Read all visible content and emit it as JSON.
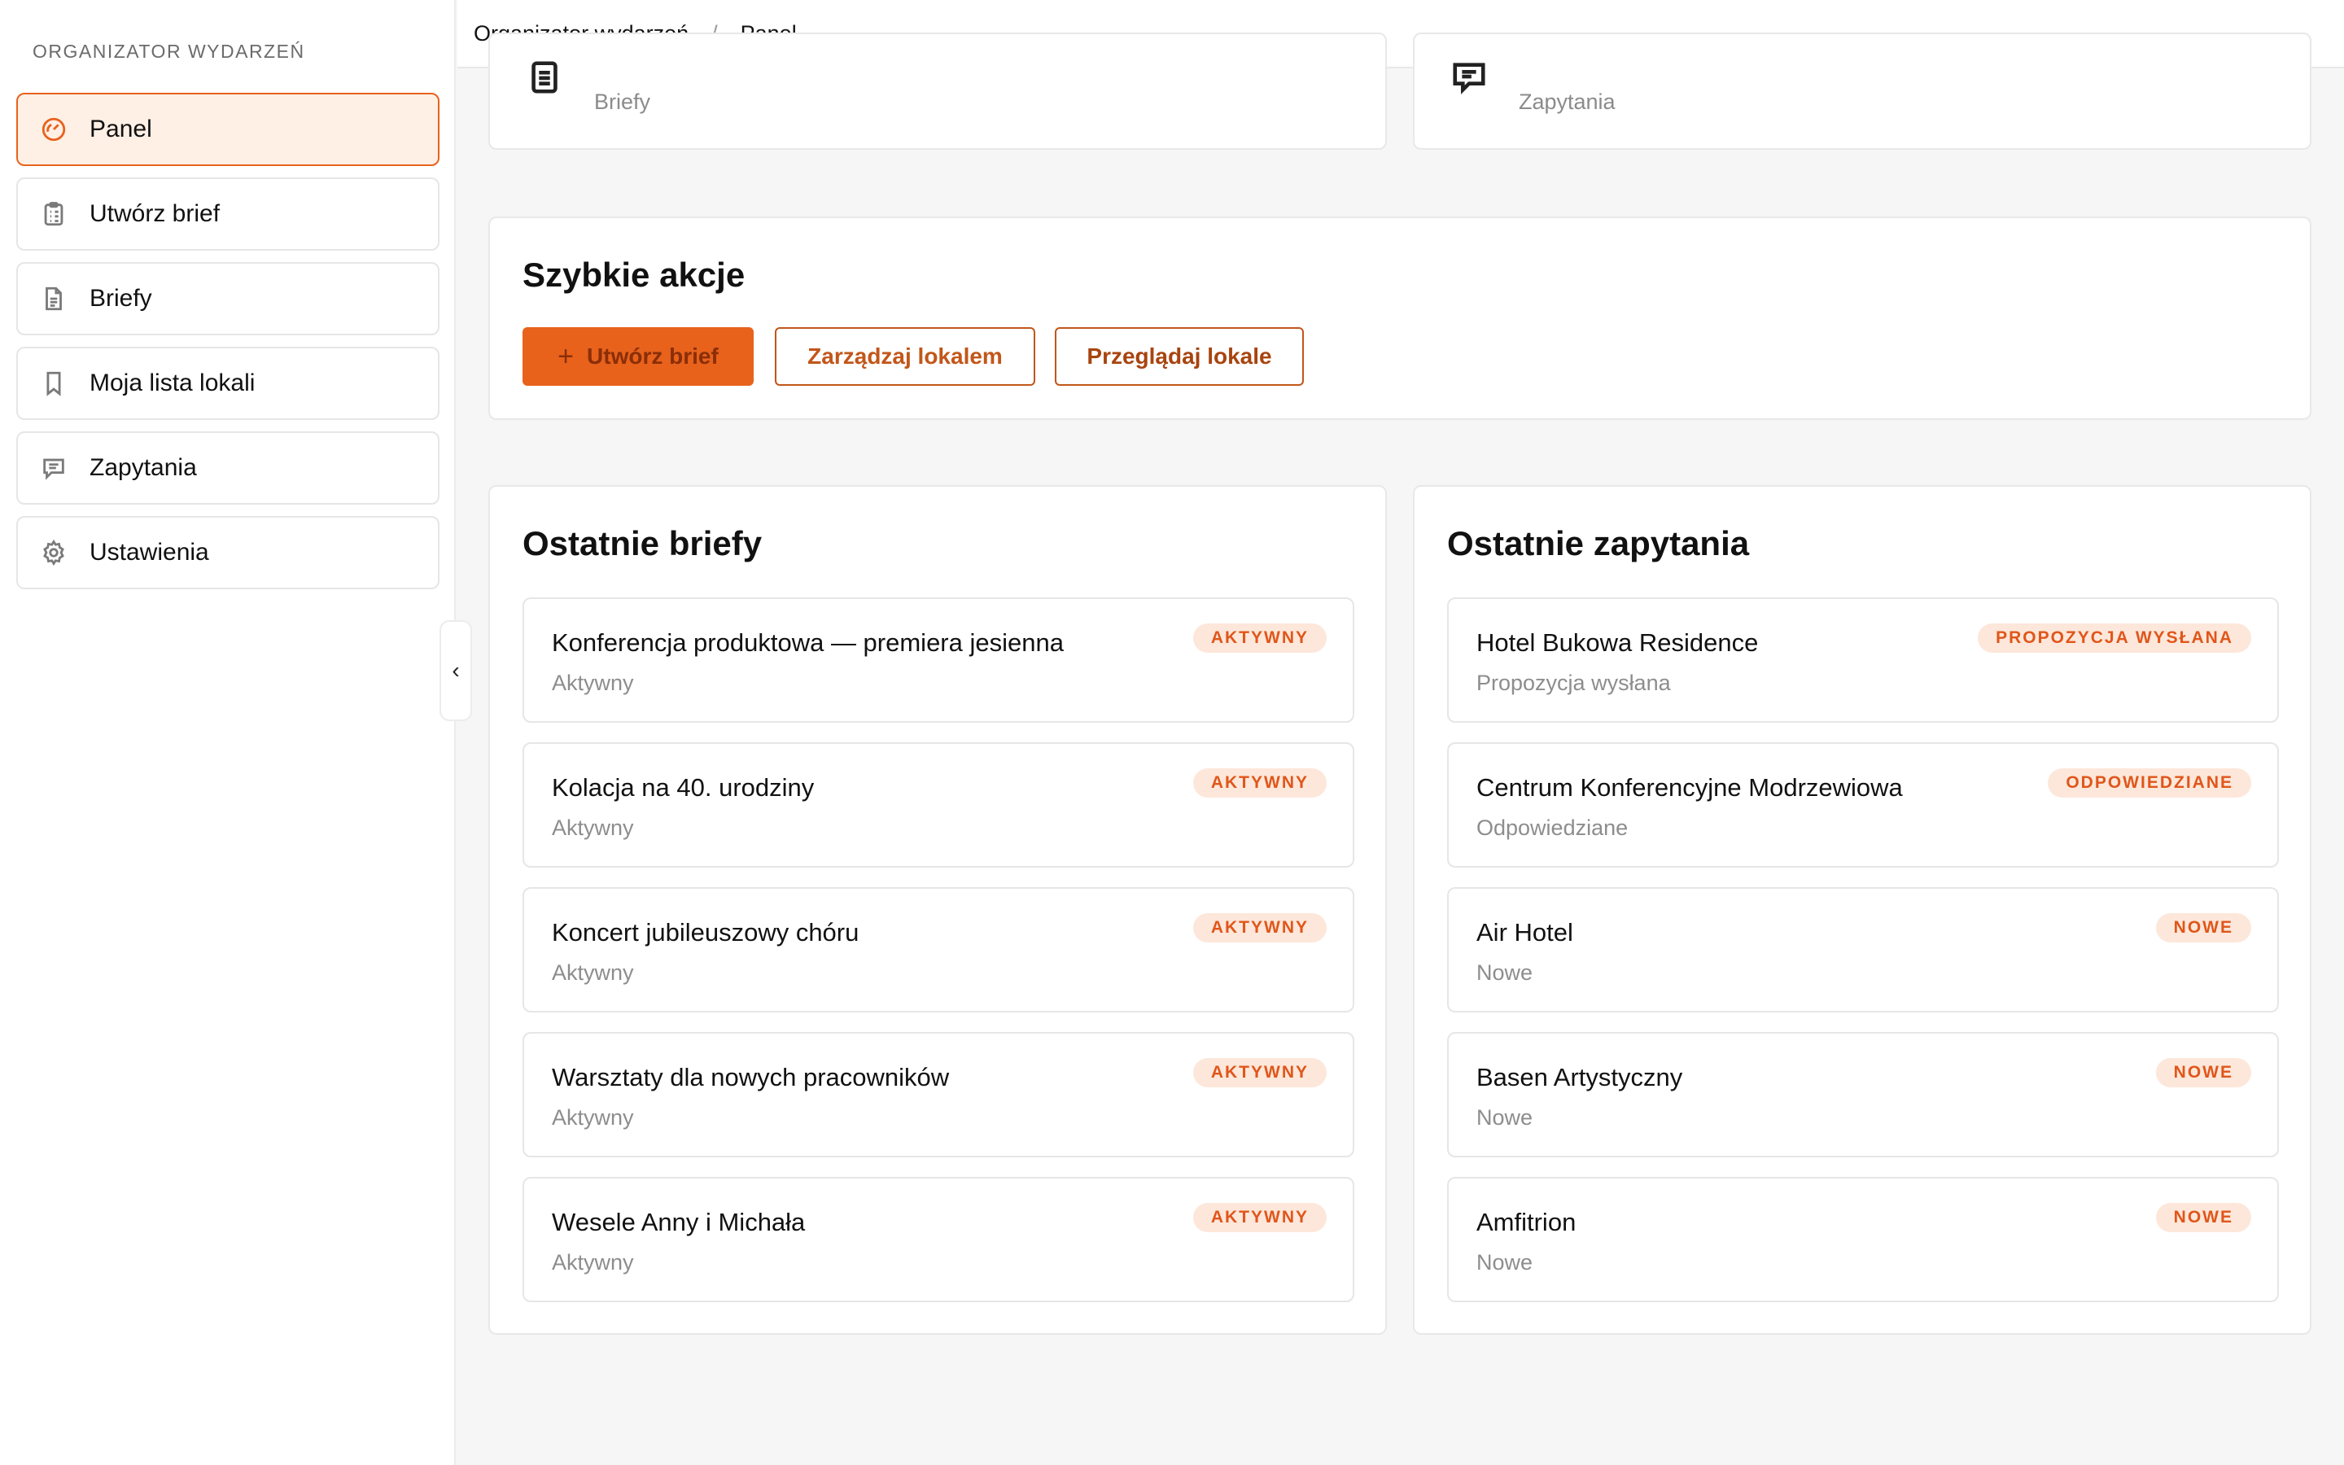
{
  "sidebar": {
    "title": "ORGANIZATOR WYDARZEŃ",
    "items": [
      {
        "label": "Panel",
        "icon": "gauge-icon",
        "active": true
      },
      {
        "label": "Utwórz brief",
        "icon": "clipboard-icon",
        "active": false
      },
      {
        "label": "Briefy",
        "icon": "document-icon",
        "active": false
      },
      {
        "label": "Moja lista lokali",
        "icon": "bookmark-icon",
        "active": false
      },
      {
        "label": "Zapytania",
        "icon": "chat-icon",
        "active": false
      },
      {
        "label": "Ustawienia",
        "icon": "gear-icon",
        "active": false
      }
    ],
    "collapse_glyph": "‹"
  },
  "breadcrumb": {
    "root": "Organizator wydarzeń",
    "separator": "/",
    "current": "Panel"
  },
  "stats": [
    {
      "label": "Briefy",
      "icon": "document-icon"
    },
    {
      "label": "Zapytania",
      "icon": "chat-icon"
    }
  ],
  "quick_actions": {
    "title": "Szybkie akcje",
    "primary_label": "Utwórz brief",
    "primary_icon": "+",
    "manage_label": "Zarządzaj lokalem",
    "browse_label": "Przeglądaj lokale"
  },
  "recent_briefs": {
    "title": "Ostatnie briefy",
    "items": [
      {
        "title": "Konferencja produktowa — premiera jesienna",
        "status": "Aktywny",
        "badge": "AKTYWNY"
      },
      {
        "title": "Kolacja na 40. urodziny",
        "status": "Aktywny",
        "badge": "AKTYWNY"
      },
      {
        "title": "Koncert jubileuszowy chóru",
        "status": "Aktywny",
        "badge": "AKTYWNY"
      },
      {
        "title": "Warsztaty dla nowych pracowników",
        "status": "Aktywny",
        "badge": "AKTYWNY"
      },
      {
        "title": "Wesele Anny i Michała",
        "status": "Aktywny",
        "badge": "AKTYWNY"
      }
    ]
  },
  "recent_inquiries": {
    "title": "Ostatnie zapytania",
    "items": [
      {
        "title": "Hotel Bukowa Residence",
        "status": "Propozycja wysłana",
        "badge": "PROPOZYCJA WYSŁANA"
      },
      {
        "title": "Centrum Konferencyjne Modrzewiowa",
        "status": "Odpowiedziane",
        "badge": "ODPOWIEDZIANE"
      },
      {
        "title": "Air Hotel",
        "status": "Nowe",
        "badge": "NOWE"
      },
      {
        "title": "Basen Artystyczny",
        "status": "Nowe",
        "badge": "NOWE"
      },
      {
        "title": "Amfitrion",
        "status": "Nowe",
        "badge": "NOWE"
      }
    ]
  },
  "colors": {
    "accent": "#e8621c",
    "accent_light": "#fff0e6",
    "badge_bg": "#fde7da",
    "badge_text": "#e0561a"
  }
}
